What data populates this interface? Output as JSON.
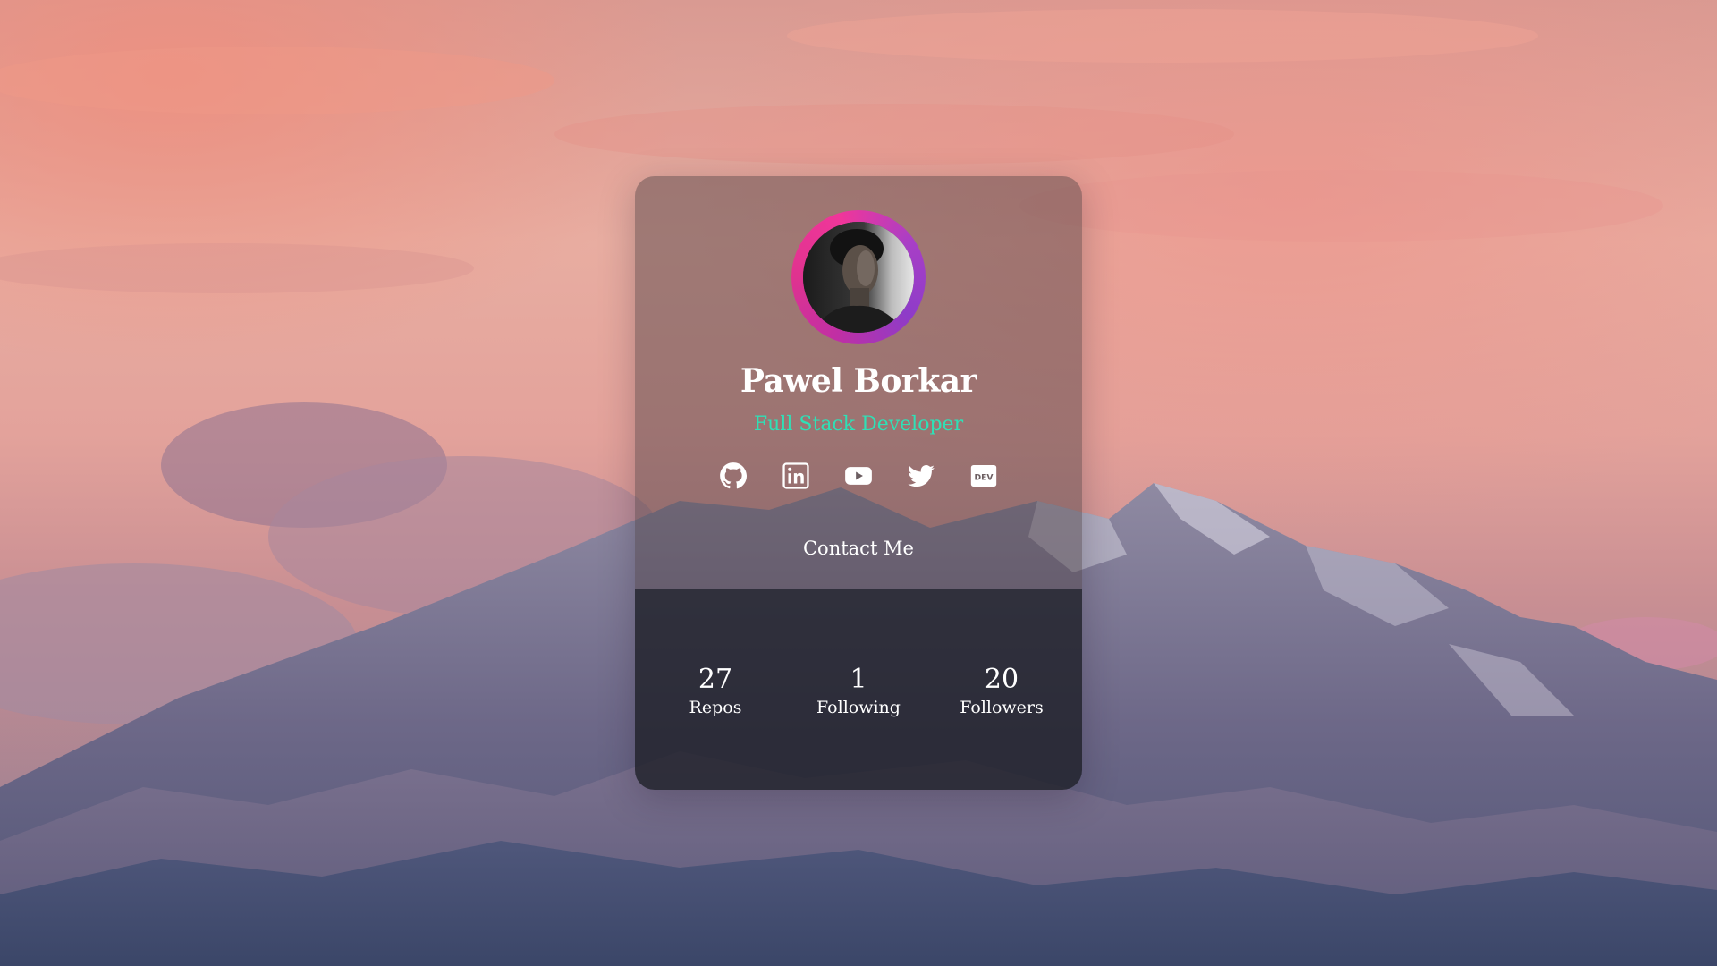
{
  "profile": {
    "name": "Pawel Borkar",
    "role": "Full Stack Developer",
    "contact_label": "Contact Me",
    "dev_badge": "DEV"
  },
  "socials": [
    {
      "icon": "github-icon"
    },
    {
      "icon": "linkedin-icon"
    },
    {
      "icon": "youtube-icon"
    },
    {
      "icon": "twitter-icon"
    },
    {
      "icon": "dev-icon"
    }
  ],
  "stats": [
    {
      "value": "27",
      "label": "Repos"
    },
    {
      "value": "1",
      "label": "Following"
    },
    {
      "value": "20",
      "label": "Followers"
    }
  ],
  "colors": {
    "role_accent": "#2fe0b6",
    "ring_pink": "#f0369a",
    "ring_purple": "#8e3cc8",
    "icon_color": "#ffffff"
  }
}
